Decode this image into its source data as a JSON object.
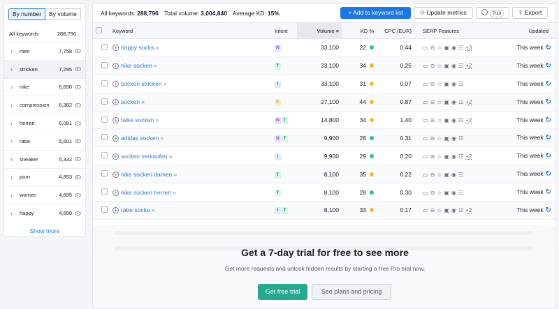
{
  "sidebar": {
    "toggle": {
      "by_number": "By number",
      "by_volume": "By volume"
    },
    "header": {
      "label": "All keywords",
      "count": "288,796"
    },
    "items": [
      {
        "label": "men",
        "count": "7,758"
      },
      {
        "label": "stricken",
        "count": "7,295"
      },
      {
        "label": "nike",
        "count": "6,696"
      },
      {
        "label": "compression",
        "count": "6,382"
      },
      {
        "label": "herren",
        "count": "6,081"
      },
      {
        "label": "rabe",
        "count": "5,601"
      },
      {
        "label": "sneaker",
        "count": "5,332"
      },
      {
        "label": "porn",
        "count": "4,853"
      },
      {
        "label": "women",
        "count": "4,695"
      },
      {
        "label": "happy",
        "count": "4,658"
      }
    ],
    "show_more": "Show more"
  },
  "topbar": {
    "all_keywords_label": "All keywords:",
    "all_keywords_value": "288,796",
    "total_volume_label": "Total volume:",
    "total_volume_value": "3,004,840",
    "avg_kd_label": "Average KD:",
    "avg_kd_value": "15%",
    "add_button": "+  Add to keyword list",
    "update_button": "Update metrics",
    "gear_badge": "7/10",
    "export_button": "Export"
  },
  "columns": {
    "keyword": "Keyword",
    "intent": "Intent",
    "volume": "Volume",
    "kd": "KD %",
    "cpc": "CPC (EUR)",
    "serp": "SERP Features",
    "updated": "Updated"
  },
  "rows": [
    {
      "keyword": "happy socks",
      "intent": [
        "N"
      ],
      "volume": "33,100",
      "kd": "22",
      "kd_color": "#2bc48a",
      "cpc": "0.44",
      "serp_more": "+3",
      "updated": "This week"
    },
    {
      "keyword": "nike socken",
      "intent": [
        "T"
      ],
      "volume": "33,100",
      "kd": "34",
      "kd_color": "#f5b82e",
      "cpc": "0.25",
      "serp_more": "+2",
      "updated": "This week"
    },
    {
      "keyword": "socken stricken",
      "intent": [
        "I"
      ],
      "volume": "33,100",
      "kd": "31",
      "kd_color": "#f5b82e",
      "cpc": "0.07",
      "serp_more": "",
      "updated": "This week"
    },
    {
      "keyword": "socken",
      "intent": [
        "C"
      ],
      "volume": "27,100",
      "kd": "44",
      "kd_color": "#f5b82e",
      "cpc": "0.87",
      "serp_more": "+2",
      "updated": "This week"
    },
    {
      "keyword": "falke socken",
      "intent": [
        "N",
        "T"
      ],
      "volume": "14,800",
      "kd": "34",
      "kd_color": "#f5b82e",
      "cpc": "1.40",
      "serp_more": "+2",
      "updated": "This week"
    },
    {
      "keyword": "adidas socken",
      "intent": [
        "N",
        "T"
      ],
      "volume": "9,900",
      "kd": "28",
      "kd_color": "#2bc48a",
      "cpc": "0.31",
      "serp_more": "",
      "updated": "This week"
    },
    {
      "keyword": "socken verkaufen",
      "intent": [
        "I"
      ],
      "volume": "9,900",
      "kd": "29",
      "kd_color": "#2bc48a",
      "cpc": "0.20",
      "serp_more": "+2",
      "updated": "This week"
    },
    {
      "keyword": "nike socken damen",
      "intent": [
        "T"
      ],
      "volume": "8,100",
      "kd": "35",
      "kd_color": "#f5b82e",
      "cpc": "0.22",
      "serp_more": "",
      "updated": "This week"
    },
    {
      "keyword": "nike socken herren",
      "intent": [
        "T"
      ],
      "volume": "8,100",
      "kd": "28",
      "kd_color": "#2bc48a",
      "cpc": "0.30",
      "serp_more": "",
      "updated": "This week"
    },
    {
      "keyword": "rabe socke",
      "intent": [
        "I",
        "T"
      ],
      "volume": "8,100",
      "kd": "33",
      "kd_color": "#f5b82e",
      "cpc": "0.17",
      "serp_more": "+2",
      "updated": "This week"
    }
  ],
  "intent_colors": {
    "N": {
      "bg": "#e9e1fb",
      "fg": "#7b4fd6"
    },
    "T": {
      "bg": "#dbf3e6",
      "fg": "#1d9b63"
    },
    "I": {
      "bg": "#dcecfb",
      "fg": "#2a7ade"
    },
    "C": {
      "bg": "#fdefc8",
      "fg": "#c8870a"
    }
  },
  "promo": {
    "title": "Get a 7-day trial for free to see more",
    "subtitle": "Get more requests and unlock hidden results by starting a free Pro trial now.",
    "trial_button": "Get free trial",
    "plans_button": "See plans and pricing"
  }
}
